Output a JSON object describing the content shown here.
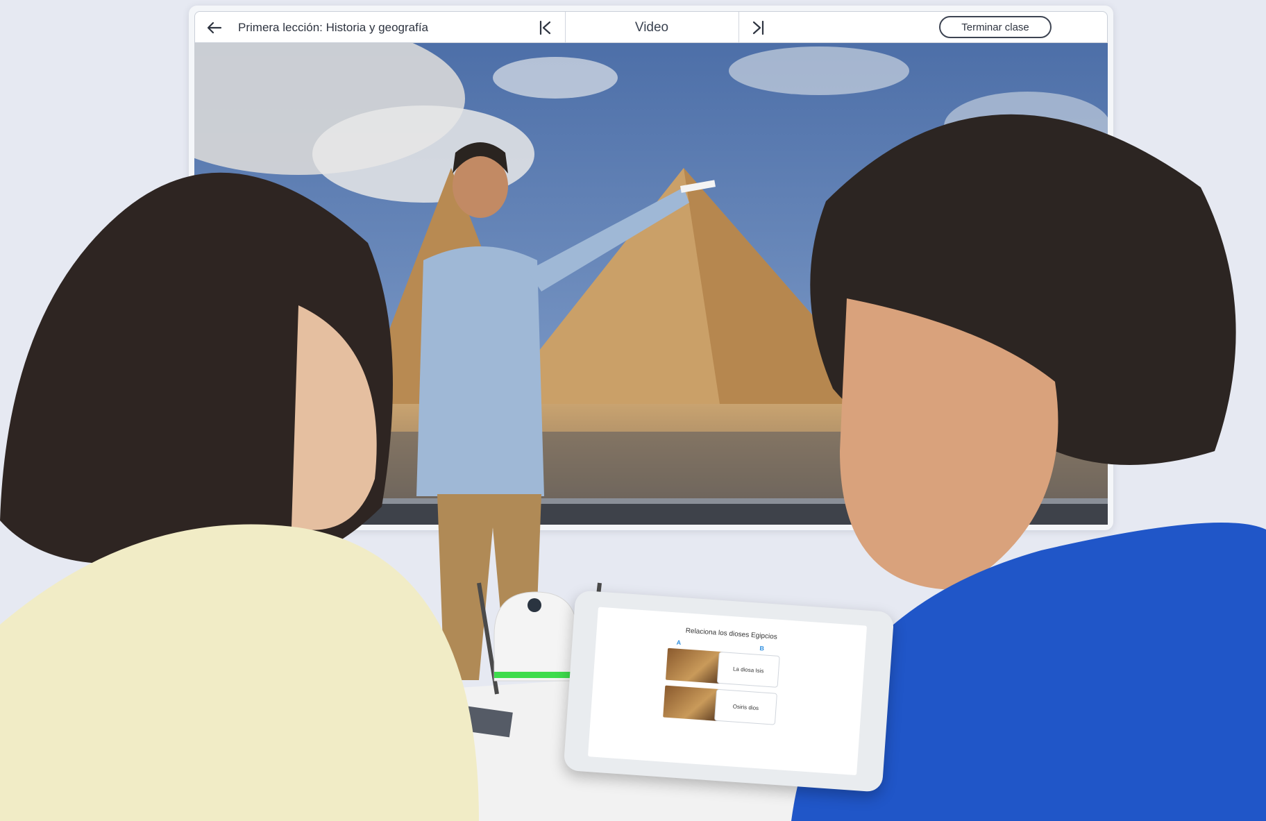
{
  "toolbar": {
    "lesson_title": "Primera lección: Historia y geografía",
    "mode_label": "Video",
    "end_class_label": "Terminar clase",
    "back_icon": "arrow-left-icon",
    "prev_icon": "skip-previous-icon",
    "next_icon": "skip-next-icon"
  },
  "video": {
    "progress_fraction": 0.06
  },
  "tablet": {
    "quiz_title": "Relaciona los dioses Egipcios",
    "column_a": "A",
    "column_b": "B",
    "options": [
      {
        "label": "La diosa Isis"
      },
      {
        "label": "Osiris dios"
      }
    ]
  },
  "colors": {
    "accent": "#2f8fe0",
    "device_led": "#3ddc4c",
    "sky": "#5a7ab0",
    "sand": "#c99a5a"
  }
}
